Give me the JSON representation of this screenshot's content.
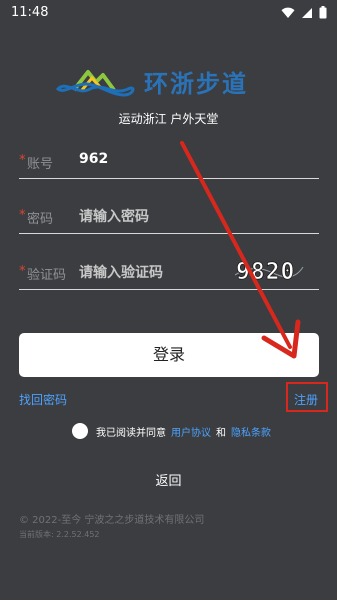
{
  "status_bar": {
    "time": "11:48",
    "icons": [
      "wifi-icon",
      "signal-icon",
      "battery-icon"
    ]
  },
  "header": {
    "logo_text": "环浙步道",
    "slogan": "运动浙江 户外天堂"
  },
  "form": {
    "account": {
      "required_mark": "*",
      "label": "账号",
      "value": "962"
    },
    "password": {
      "required_mark": "*",
      "label": "密码",
      "placeholder": "请输入密码"
    },
    "captcha": {
      "required_mark": "*",
      "label": "验证码",
      "placeholder": "请输入验证码",
      "captcha_text": "9820"
    }
  },
  "actions": {
    "login_label": "登录",
    "forgot_password": "找回密码",
    "register": "注册"
  },
  "agreement": {
    "prefix": "我已阅读并同意",
    "user_agreement": "用户协议",
    "and": "和",
    "privacy_policy": "隐私条款"
  },
  "back_label": "返回",
  "footer": {
    "copyright": "© 2022-至今 宁波之之步道技术有限公司",
    "version": "当前版本: 2.2.52.452"
  },
  "colors": {
    "background": "#3b3d40",
    "link": "#4da3ff",
    "annotation": "#d8281e",
    "required": "#d9482f"
  }
}
